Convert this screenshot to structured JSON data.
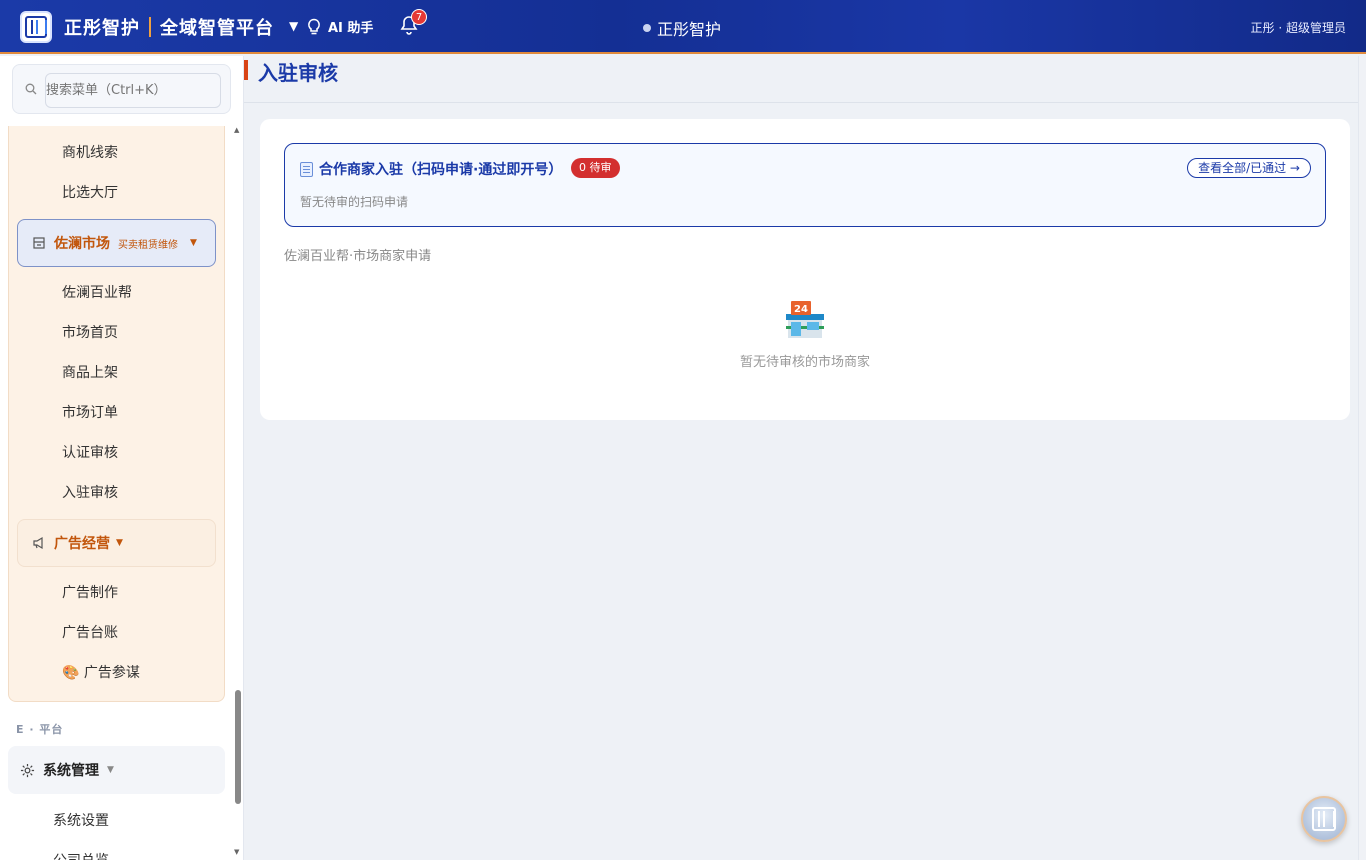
{
  "header": {
    "brand_name": "正彤智护",
    "platform_name": "全域智管平台",
    "brand_caret": "▼",
    "ai_label": "AI 助手",
    "notification_count": "7",
    "center_title": "正彤智护",
    "user_label": "正彤 · 超级管理员"
  },
  "sidebar": {
    "search_placeholder": "搜索菜单（Ctrl+K）",
    "top_items": [
      "商机线索",
      "比选大厅"
    ],
    "market_group": {
      "label": "佐澜市场",
      "tag": "买卖租赁维修",
      "caret": "▼"
    },
    "market_items": [
      "佐澜百业帮",
      "市场首页",
      "商品上架",
      "市场订单",
      "认证审核",
      "入驻审核"
    ],
    "ads_group": {
      "label": "广告经营",
      "caret": "▼"
    },
    "ads_items": [
      "广告制作",
      "广告台账",
      "🎨 广告参谋"
    ],
    "section_label": "E · 平台",
    "system_group": {
      "label": "系统管理",
      "caret": "▼"
    },
    "system_items": [
      "系统设置",
      "公司总览"
    ]
  },
  "main": {
    "page_title": "入驻审核",
    "partner": {
      "title": "合作商家入驻（扫码申请·通过即开号）",
      "pending_badge": "0 待审",
      "view_all": "查看全部/已通过 →",
      "empty": "暂无待审的扫码申请"
    },
    "market_section_label": "佐澜百业帮·市场商家申请",
    "empty_text": "暂无待审核的市场商家"
  },
  "colors": {
    "header_bg": "#1b3aa8",
    "accent_orange": "#c2560c",
    "badge_red": "#d32f2f",
    "page_title_blue": "#1b3aa8"
  }
}
